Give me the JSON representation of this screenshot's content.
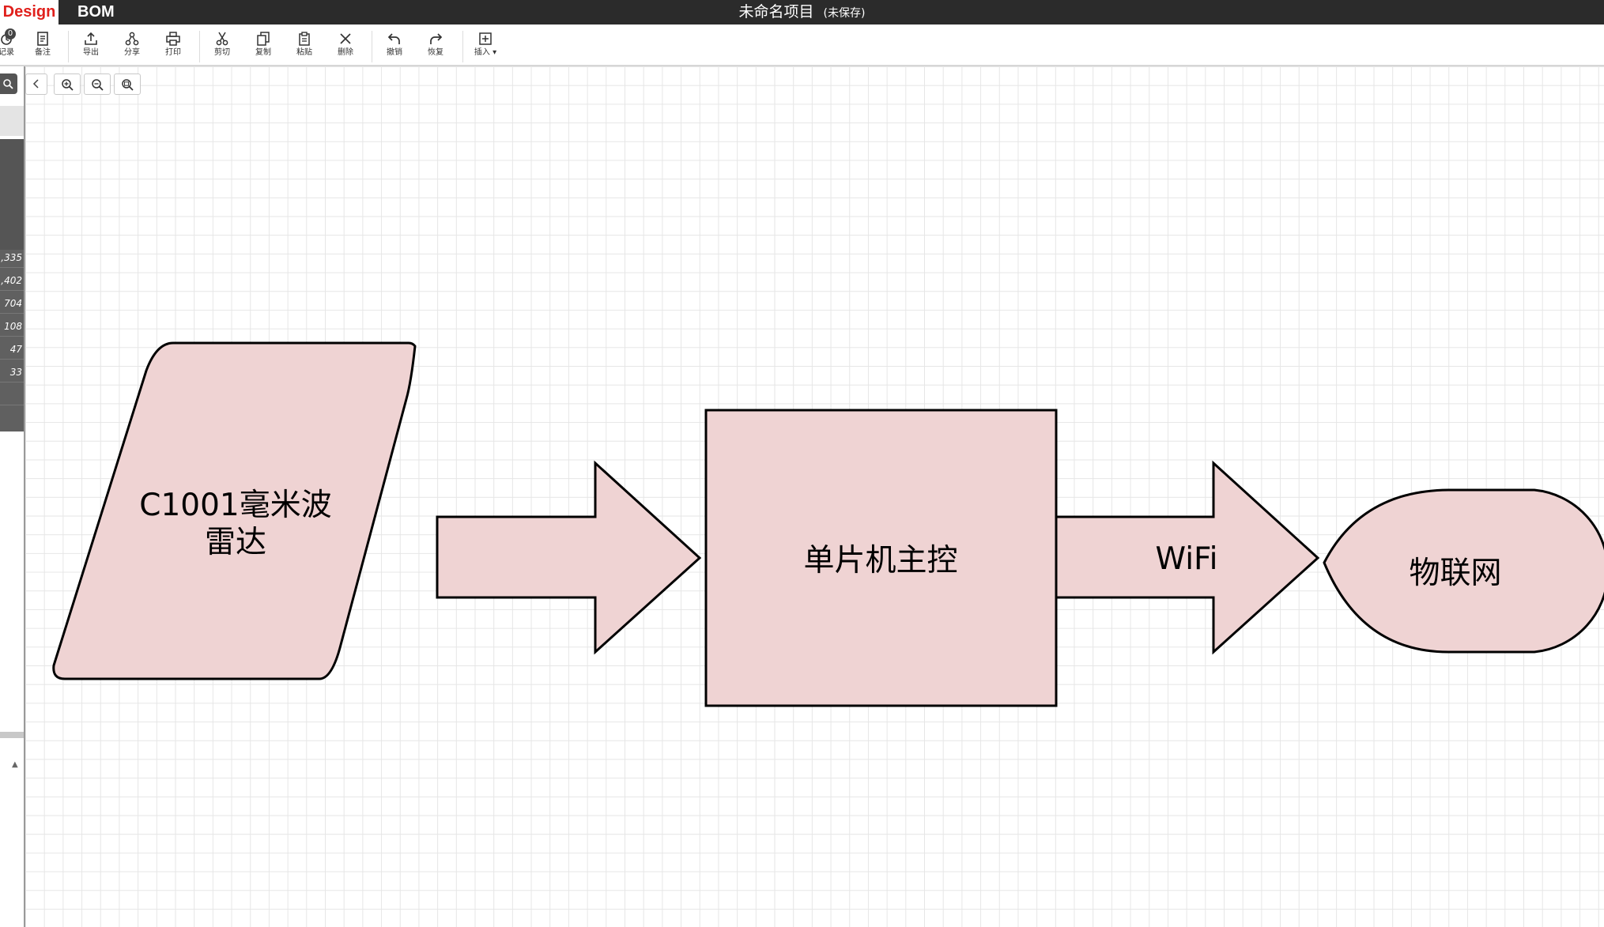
{
  "header": {
    "tabs": [
      {
        "label": "Design",
        "active": true
      },
      {
        "label": "BOM",
        "active": false
      }
    ],
    "project_title": "未命名项目",
    "save_status": "(未保存)"
  },
  "toolbar": {
    "history_badge": "0",
    "buttons": [
      {
        "label": "记录",
        "icon": "history-icon"
      },
      {
        "label": "备注",
        "icon": "note-icon"
      },
      {
        "label": "导出",
        "icon": "export-icon"
      },
      {
        "label": "分享",
        "icon": "share-icon"
      },
      {
        "label": "打印",
        "icon": "print-icon"
      },
      {
        "label": "剪切",
        "icon": "cut-icon"
      },
      {
        "label": "复制",
        "icon": "copy-icon"
      },
      {
        "label": "粘贴",
        "icon": "paste-icon"
      },
      {
        "label": "删除",
        "icon": "delete-icon"
      },
      {
        "label": "撤销",
        "icon": "undo-icon"
      },
      {
        "label": "恢复",
        "icon": "redo-icon"
      },
      {
        "label": "插入",
        "icon": "insert-icon"
      }
    ]
  },
  "left_panel": {
    "values": [
      ",335",
      ",402",
      "704",
      "108",
      "47",
      "33"
    ]
  },
  "diagram": {
    "fill_color": "#efd3d3",
    "stroke_color": "#000000",
    "nodes": [
      {
        "id": "radar",
        "shape": "parallelogram",
        "label_line1": "C1001毫米波",
        "label_line2": "雷达"
      },
      {
        "id": "mcu",
        "shape": "rectangle",
        "label": "单片机主控"
      },
      {
        "id": "iot",
        "shape": "display",
        "label": "物联网"
      }
    ],
    "edges": [
      {
        "from": "radar",
        "to": "mcu",
        "shape": "block-arrow",
        "label": ""
      },
      {
        "from": "mcu",
        "to": "iot",
        "shape": "block-arrow",
        "label": "WiFi"
      }
    ]
  }
}
